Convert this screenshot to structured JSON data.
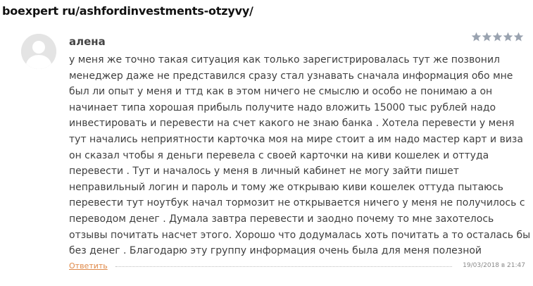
{
  "site": {
    "url": "boexpert ru/ashfordinvestments-otzyvy/"
  },
  "comment": {
    "avatar_icon": "user-silhouette-icon",
    "author": "алена",
    "rating": {
      "value": 5,
      "max": 5,
      "star_color": "#9aa3b0"
    },
    "text_lines": [
      "у меня же точно такая ситуация как только зарегистрировалась тут же позвонил",
      "менеджер даже не представился сразу стал узнавать сначала информация обо мне",
      "был ли опыт у меня и ттд как в этом ничего не смыслю и особо не понимаю а он",
      "начинает типа хорошая прибыль получите надо вложить 15000 тыс рублей надо",
      "инвестировать и перевести на счет какого не знаю банка . Хотела перевести у меня",
      "тут начались неприятности карточка моя на мире стоит а им надо мастер карт и виза",
      "он сказал чтобы я деньги перевела с своей карточки на киви кошелек и оттуда",
      "перевести . Тут и началось у меня в личный кабинет не могу зайти пишет",
      "неправильный логин и пароль и тому же открываю киви кошелек оттуда пытаюсь",
      "перевести тут ноутбук начал тормозит не открывается ничего у меня не получилось с",
      "переводом денег . Думала завтра перевести и заодно почему то мне захотелось",
      "отзывы почитать насчет этого. Хорошо что додумалась хоть почитать а то осталась бы",
      "без денег . Благодарю эту группу информация очень была для меня полезной"
    ],
    "reply_label": "Ответить",
    "reply_color": "#e08a4a",
    "timestamp": "19/03/2018 в 21:47"
  }
}
